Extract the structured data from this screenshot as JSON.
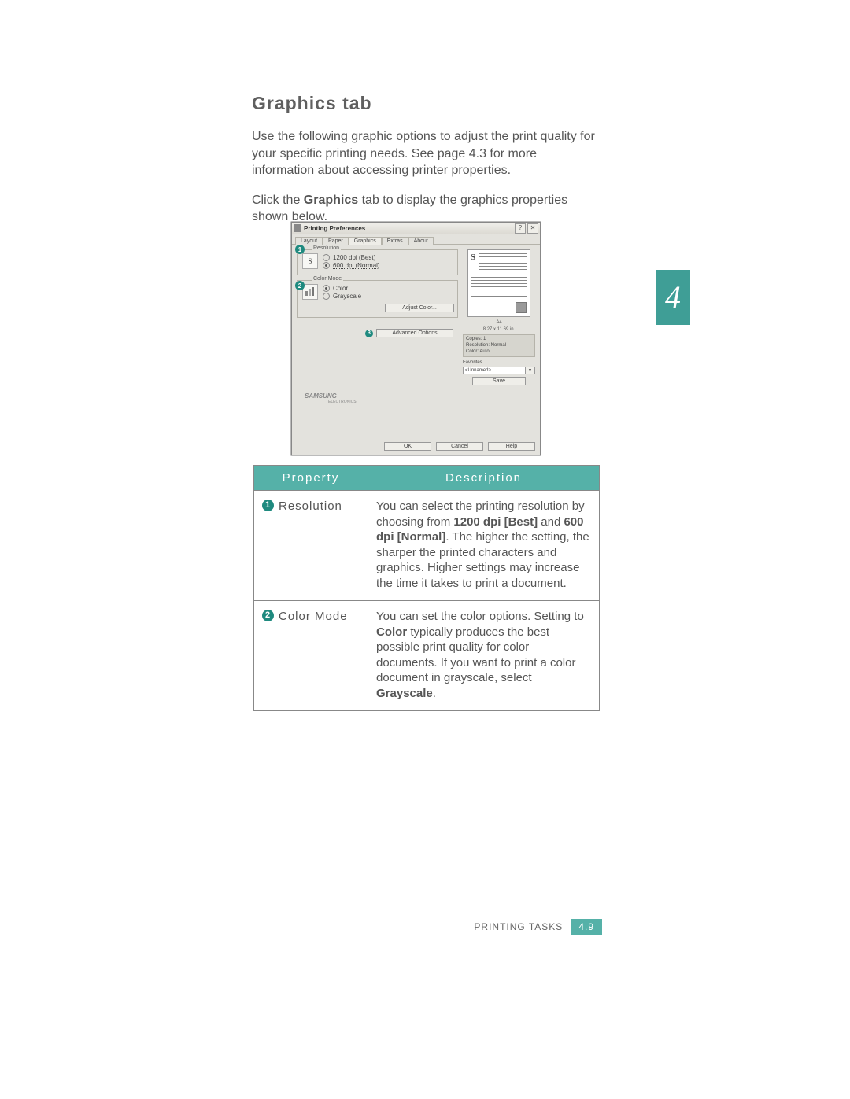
{
  "section_title": "Graphics tab",
  "intro_p1": "Use the following graphic options to adjust the print quality for your specific printing needs. See page 4.3 for more information about accessing printer properties.",
  "intro_p2_pre": "Click the ",
  "intro_p2_bold": "Graphics",
  "intro_p2_post": " tab to display the graphics properties shown below.",
  "chapter_num": "4",
  "dialog": {
    "title": "Printing Preferences",
    "help_btn": "?",
    "close_btn": "✕",
    "tabs": [
      "Layout",
      "Paper",
      "Graphics",
      "Extras",
      "About"
    ],
    "resolution": {
      "legend": "Resolution",
      "icon_letter": "S",
      "opt1": "1200 dpi (Best)",
      "opt2": "600 dpi (Normal)"
    },
    "color_mode": {
      "legend": "Color Mode",
      "opt1": "Color",
      "opt2": "Grayscale",
      "adjust_btn": "Adjust Color..."
    },
    "advanced_btn": "Advanced Options",
    "preview": {
      "paper": "A4",
      "dims": "8.27 x 11.69 in.",
      "copies": "Copies: 1",
      "resolution": "Resolution: Normal",
      "color": "Color: Auto",
      "favorites_label": "Favorites",
      "favorites_value": "<Unnamed>",
      "save_btn": "Save"
    },
    "brand": "SAMSUNG",
    "brand_sub": "ELECTRONICS",
    "ok_btn": "OK",
    "cancel_btn": "Cancel",
    "dlg_help_btn": "Help"
  },
  "callouts": {
    "c1": "1",
    "c2": "2",
    "c3": "3"
  },
  "table": {
    "h1": "Property",
    "h2": "Description",
    "rows": [
      {
        "num": "1",
        "name": "Resolution",
        "desc_parts": [
          {
            "t": "You can select the printing resolution by choosing from "
          },
          {
            "t": "1200 dpi [Best]",
            "b": true
          },
          {
            "t": " and "
          },
          {
            "t": "600 dpi [Normal]",
            "b": true
          },
          {
            "t": ". The higher the setting, the sharper the printed characters and graphics. Higher settings may increase the time it takes to print a document."
          }
        ]
      },
      {
        "num": "2",
        "name": "Color Mode",
        "desc_parts": [
          {
            "t": "You can set the color options. Setting to "
          },
          {
            "t": "Color",
            "b": true
          },
          {
            "t": " typically produces the best possible print quality for color documents. If you want to print a color document in grayscale, select "
          },
          {
            "t": "Grayscale",
            "b": true
          },
          {
            "t": "."
          }
        ]
      }
    ]
  },
  "footer": {
    "label": "PRINTING TASKS",
    "page": "4.9"
  }
}
